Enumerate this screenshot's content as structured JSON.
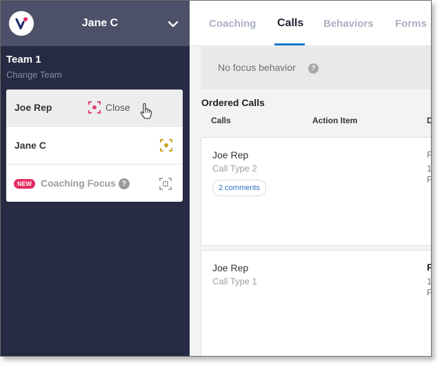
{
  "header": {
    "user_name": "Jane C"
  },
  "sidebar": {
    "team_name": "Team 1",
    "change_team_label": "Change Team",
    "reps": [
      {
        "name": "Joe Rep",
        "action_label": "Close",
        "icon": "focus-target-icon"
      },
      {
        "name": "Jane C",
        "icon": "focus-target-icon"
      }
    ],
    "coaching_focus": {
      "badge": "NEW",
      "label": "Coaching Focus",
      "help": "?",
      "icon": "grid-focus-icon"
    }
  },
  "tabs": [
    {
      "label": "Coaching",
      "active": false
    },
    {
      "label": "Calls",
      "active": true
    },
    {
      "label": "Behaviors",
      "active": false
    },
    {
      "label": "Forms",
      "active": false
    }
  ],
  "main": {
    "focus_banner_text": "No focus behavior",
    "focus_help": "?",
    "ordered_calls_title": "Ordered Calls",
    "columns": [
      "Calls",
      "Action Item",
      "D"
    ],
    "calls": [
      {
        "rep": "Joe Rep",
        "type": "Call Type 2",
        "comments": "2 comments",
        "trunc": [
          "F",
          "1",
          "P"
        ]
      },
      {
        "rep": "Joe Rep",
        "type": "Call Type 1",
        "trunc": [
          "F",
          "1",
          "P"
        ]
      }
    ]
  },
  "colors": {
    "sidebar_bg": "#262a42",
    "topbar_bg": "#4c5169",
    "accent_blue": "#1976d2",
    "close_icon_pink": "#e0427c",
    "focus_icon_gold": "#c9a227",
    "new_badge_red": "#e52a5f"
  }
}
